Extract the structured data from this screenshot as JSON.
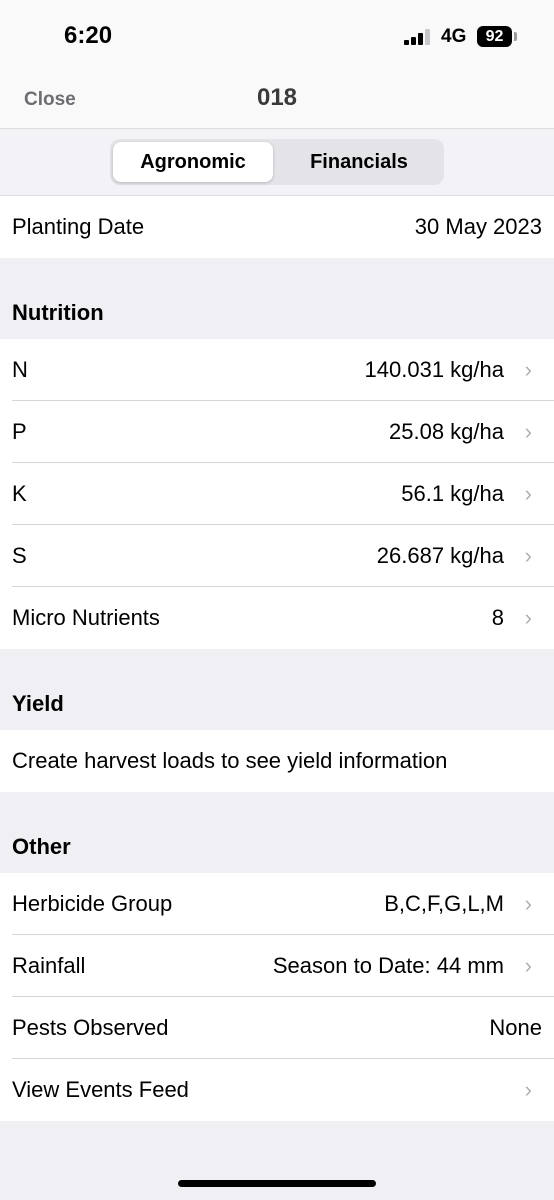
{
  "status_bar": {
    "time": "6:20",
    "network": "4G",
    "battery": "92"
  },
  "nav": {
    "close_label": "Close",
    "title": "018"
  },
  "segments": {
    "active": "Agronomic",
    "inactive": "Financials"
  },
  "planting": {
    "label": "Planting Date",
    "value": "30 May 2023"
  },
  "nutrition": {
    "header": "Nutrition",
    "items": [
      {
        "label": "N",
        "value": "140.031 kg/ha"
      },
      {
        "label": "P",
        "value": "25.08 kg/ha"
      },
      {
        "label": "K",
        "value": "56.1 kg/ha"
      },
      {
        "label": "S",
        "value": "26.687 kg/ha"
      },
      {
        "label": "Micro Nutrients",
        "value": "8"
      }
    ]
  },
  "yield": {
    "header": "Yield",
    "message": "Create harvest loads to see yield information"
  },
  "other": {
    "header": "Other",
    "herbicide": {
      "label": "Herbicide Group",
      "value": "B,C,F,G,L,M"
    },
    "rainfall": {
      "label": "Rainfall",
      "value": "Season to Date: 44 mm"
    },
    "pests": {
      "label": "Pests Observed",
      "value": "None"
    },
    "events": {
      "label": "View Events Feed"
    }
  },
  "icons": {
    "chevron": "›"
  }
}
